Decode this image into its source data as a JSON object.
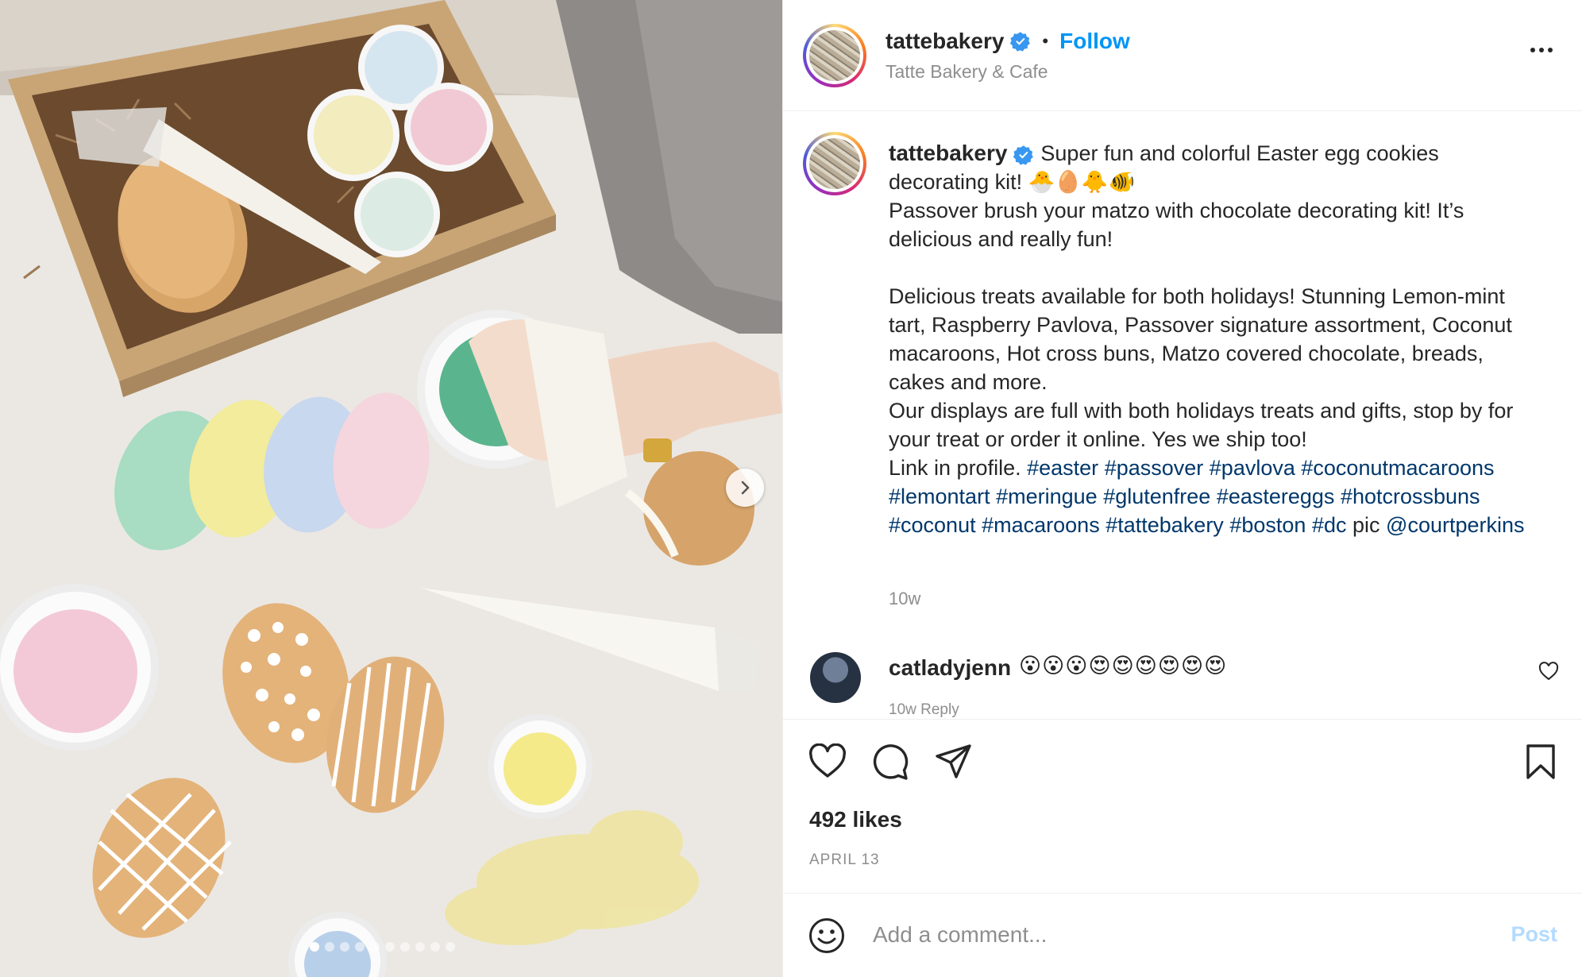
{
  "post": {
    "username": "tattebakery",
    "follow_label": "Follow",
    "location": "Tatte Bakery & Cafe",
    "separator": "•"
  },
  "caption": {
    "username": "tattebakery",
    "line1": "Super fun and colorful Easter egg cookies decorating kit! 🐣🥚🐥🐠",
    "line2": "Passover brush your matzo with chocolate decorating kit! It’s delicious and really fun!",
    "line3": "Delicious treats available for both holidays! Stunning Lemon-mint tart, Raspberry Pavlova, Passover signature assortment, Coconut macaroons, Hot cross buns, Matzo covered chocolate, breads, cakes and more.",
    "line4": "Our displays are full with both holidays treats and gifts, stop by for your treat or order it online. Yes we ship too!",
    "link_prefix": "Link in profile.",
    "hashtags": [
      "#easter",
      "#passover",
      "#pavlova",
      "#coconutmacaroons",
      "#lemontart",
      "#meringue",
      "#glutenfree",
      "#eastereggs",
      "#hotcrossbuns",
      "#coconut",
      "#macaroons",
      "#tattebakery",
      "#boston",
      "#dc"
    ],
    "pic_label": "pic",
    "mention": "@courtperkins",
    "time": "10w"
  },
  "comment": {
    "username": "catladyjenn",
    "text": "😮😮😮😍😍😍😍😍😍",
    "meta": "10w Reply"
  },
  "actions": {
    "likes": "492 likes",
    "date": "APRIL 13"
  },
  "add_comment": {
    "placeholder": "Add a comment...",
    "post_label": "Post"
  },
  "carousel": {
    "total": 10,
    "active": 1
  },
  "icons": {
    "verified": "verified-badge-icon",
    "more": "more-options-icon",
    "like": "heart-icon",
    "comment": "comment-icon",
    "share": "paper-plane-icon",
    "save": "bookmark-icon",
    "emoji": "emoji-icon",
    "next": "chevron-right-icon"
  },
  "colors": {
    "follow": "#0095f6",
    "hashtag": "#00376b",
    "post_disabled": "#b3dbff",
    "verified": "#3897f0"
  }
}
